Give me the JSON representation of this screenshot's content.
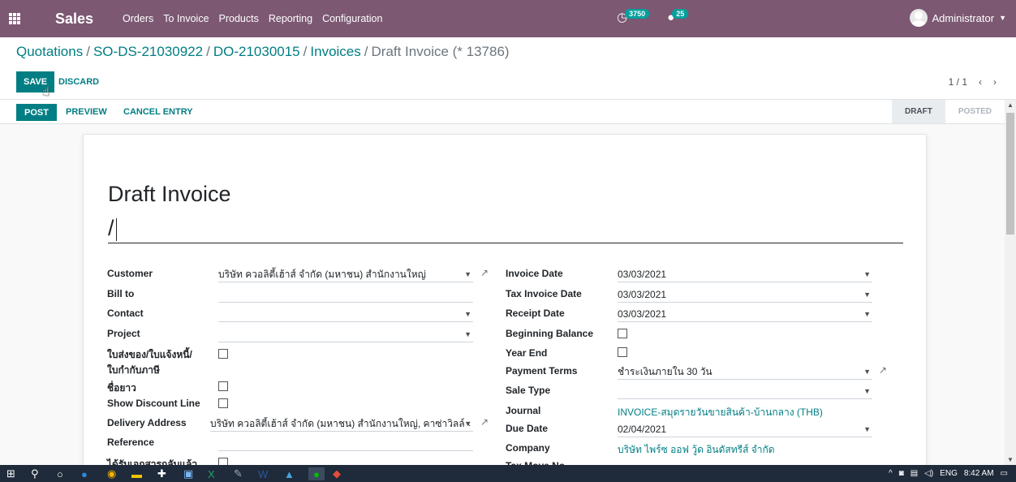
{
  "navbar": {
    "app_name": "Sales",
    "menu": [
      "Orders",
      "To Invoice",
      "Products",
      "Reporting",
      "Configuration"
    ],
    "activity_count": "3750",
    "messages_count": "25",
    "user": "Administrator"
  },
  "breadcrumb": {
    "items": [
      "Quotations",
      "SO-DS-21030922",
      "DO-21030015",
      "Invoices"
    ],
    "current": "Draft Invoice (* 13786)"
  },
  "actions": {
    "save": "SAVE",
    "discard": "DISCARD",
    "pager": "1 / 1"
  },
  "statusbar": {
    "post": "POST",
    "preview": "PREVIEW",
    "cancel_entry": "CANCEL ENTRY",
    "stage_draft": "DRAFT",
    "stage_posted": "POSTED"
  },
  "form": {
    "title": "Draft Invoice",
    "name": "/",
    "left": {
      "customer_label": "Customer",
      "customer_value": "บริษัท ควอลิตี้เฮ้าส์ จำกัด (มหาชน) สำนักงานใหญ่",
      "bill_to_label": "Bill to",
      "contact_label": "Contact",
      "project_label": "Project",
      "delivery_note_label_1": "ใบส่งของ/ใบแจ้งหนี้/",
      "delivery_note_label_2": "ใบกำกับภาษี",
      "long_name_label": "ชื่อยาว",
      "show_discount_label": "Show Discount Line",
      "delivery_address_label": "Delivery Address",
      "delivery_address_value": "บริษัท ควอลิตี้เฮ้าส์ จำกัด (มหาชน) สำนักงานใหญ่, คาซ่าวิลล์ ‹",
      "reference_label": "Reference",
      "docs_received_label": "ได้รับเอกสารกลับแล้ว"
    },
    "right": {
      "invoice_date_label": "Invoice Date",
      "invoice_date_value": "03/03/2021",
      "tax_invoice_date_label": "Tax Invoice Date",
      "tax_invoice_date_value": "03/03/2021",
      "receipt_date_label": "Receipt Date",
      "receipt_date_value": "03/03/2021",
      "beginning_balance_label": "Beginning Balance",
      "year_end_label": "Year End",
      "payment_terms_label": "Payment Terms",
      "payment_terms_value": "ชำระเงินภายใน 30 วัน",
      "sale_type_label": "Sale Type",
      "journal_label": "Journal",
      "journal_value": "INVOICE-สมุดรายวันขายสินค้า-บ้านกลาง (THB)",
      "due_date_label": "Due Date",
      "due_date_value": "02/04/2021",
      "company_label": "Company",
      "company_value": "บริษัท ไพร์ซ ออฟ วู้ด อินดัสทรีส์ จำกัด",
      "tax_move_label": "Tax Move No"
    }
  },
  "taskbar": {
    "lang": "ENG",
    "time": "8:42 AM"
  }
}
